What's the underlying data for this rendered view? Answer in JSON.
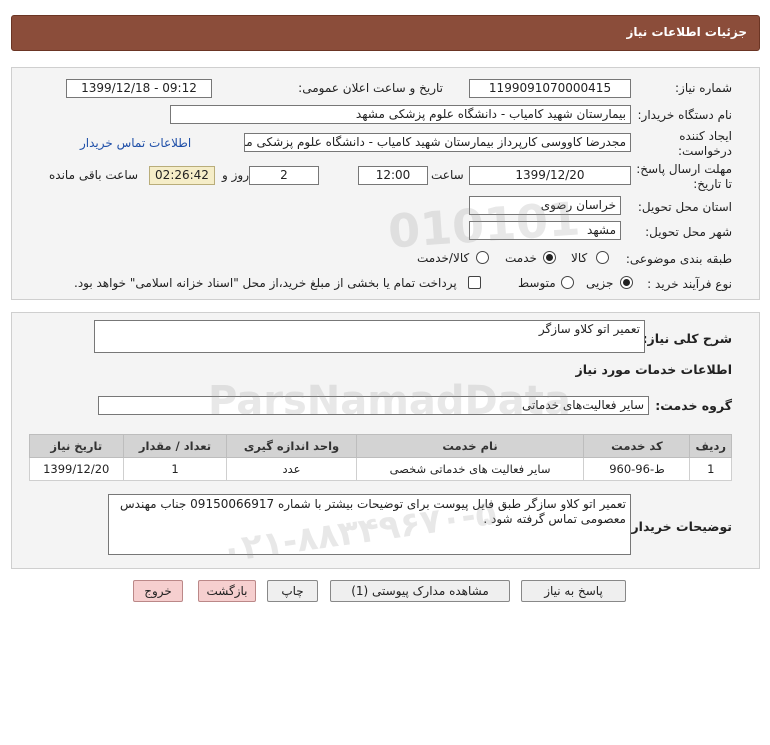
{
  "header": {
    "title": "جزئیات اطلاعات نیاز"
  },
  "form": {
    "need_number_label": "شماره نیاز:",
    "need_number": "1199091070000415",
    "announce_label": "تاریخ و ساعت اعلان عمومی:",
    "announce_value": "1399/12/18 - 09:12",
    "buyer_org_label": "نام دستگاه خریدار:",
    "buyer_org": "بیمارستان شهید کامیاب - دانشگاه علوم پزشکی مشهد",
    "creator_label_1": "ایجاد کننده",
    "creator_label_2": "درخواست:",
    "creator": "مجدرضا کاووسی کارپرداز بیمارستان شهید کامیاب - دانشگاه علوم پزشکی مشهد",
    "contact_link": "اطلاعات تماس خریدار",
    "deadline_label_1": "مهلت ارسال پاسخ:",
    "deadline_label_2": "تا تاریخ:",
    "deadline_date": "1399/12/20",
    "time_label": "ساعت",
    "deadline_time": "12:00",
    "days_value": "2",
    "days_label": "روز و",
    "remaining_time": "02:26:42",
    "remaining_label": "ساعت باقی مانده",
    "province_label": "استان محل تحویل:",
    "province": "خراسان رضوی",
    "city_label": "شهر محل تحویل:",
    "city": "مشهد",
    "category_label": "طبقه بندی موضوعی:",
    "category_options": [
      "کالا",
      "خدمت",
      "کالا/خدمت"
    ],
    "category_selected": "خدمت",
    "process_label": "نوع فرآیند خرید :",
    "process_options": [
      "جزیی",
      "متوسط"
    ],
    "process_selected": "جزیی",
    "payment_note": "پرداخت تمام یا بخشی از مبلغ خرید،از محل \"اسناد خزانه اسلامی\" خواهد بود."
  },
  "details": {
    "summary_label": "شرح کلی نیاز:",
    "summary": "تعمیر اتو کلاو سازگر",
    "services_title": "اطلاعات خدمات مورد نیاز",
    "service_group_label": "گروه خدمت:",
    "service_group": "سایر فعالیت‌های خدماتی",
    "table_headers": [
      "ردیف",
      "کد خدمت",
      "نام خدمت",
      "واحد اندازه گیری",
      "تعداد / مقدار",
      "تاریخ نیاز"
    ],
    "table_rows": [
      [
        "1",
        "ط-96-960",
        "سایر فعالیت های خدماتی شخصی",
        "عدد",
        "1",
        "1399/12/20"
      ]
    ],
    "buyer_notes_label": "توضیحات خریدار:",
    "buyer_notes": "تعمیر اتو کلاو سازگر طبق فایل پیوست برای توضیحات بیشتر با شماره 09150066917 جناب مهندس معصومی تماس گرفته شود ."
  },
  "buttons": {
    "reply": "پاسخ به نیاز",
    "attachments": "مشاهده مدارک پیوستی (1)",
    "print": "چاپ",
    "back": "بازگشت",
    "exit": "خروج"
  },
  "watermark": {
    "brand": "ParsNamadData",
    "phone": "۰۲۱-۸۸۳۴۹۶۷۰-۵",
    "number": "010101"
  }
}
